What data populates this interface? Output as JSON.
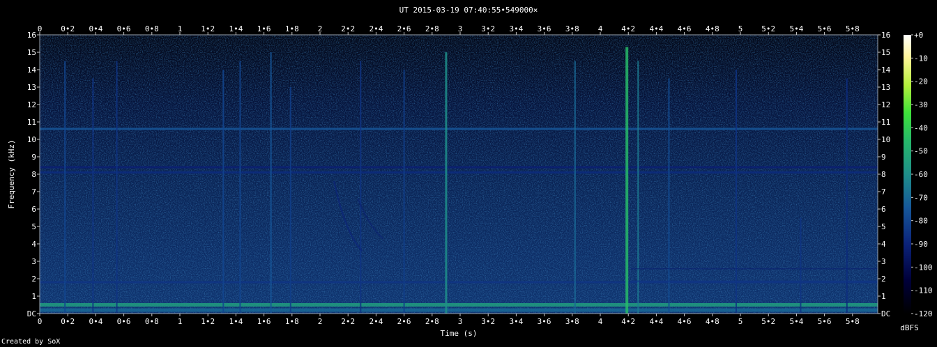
{
  "title": "UT 2015-03-19 07:40:55•549000×",
  "credit": "Created by SoX",
  "chart_data": {
    "type": "heatmap",
    "title": "UT 2015-03-19 07:40:55•549000×",
    "xlabel": "Time (s)",
    "ylabel": "Frequency (kHz)",
    "colorbar_label": "dBFS",
    "xlim": [
      0,
      5.98
    ],
    "ylim": [
      0,
      16
    ],
    "x_ticks": [
      "0",
      "0•2",
      "0•4",
      "0•6",
      "0•8",
      "1",
      "1•2",
      "1•4",
      "1•6",
      "1•8",
      "2",
      "2•2",
      "2•4",
      "2•6",
      "2•8",
      "3",
      "3•2",
      "3•4",
      "3•6",
      "3•8",
      "4",
      "4•2",
      "4•4",
      "4•6",
      "4•8",
      "5",
      "5•2",
      "5•4",
      "5•6",
      "5•8"
    ],
    "y_ticks": [
      "DC",
      "1",
      "2",
      "3",
      "4",
      "5",
      "6",
      "7",
      "8",
      "9",
      "10",
      "11",
      "12",
      "13",
      "14",
      "15",
      "16"
    ],
    "colorbar_ticks": [
      "+0",
      "-10",
      "-20",
      "-30",
      "-40",
      "-50",
      "-60",
      "-70",
      "-80",
      "-90",
      "-100",
      "-110",
      "-120"
    ],
    "colorbar_range": [
      -120,
      0
    ],
    "colors": [
      "#000000",
      "#000035",
      "#0a1f6e",
      "#134f8f",
      "#1f8a8a",
      "#25b86a",
      "#35e33a",
      "#bff04a",
      "#ffffc0",
      "#ffffff"
    ],
    "horizontal_lines_khz": [
      {
        "freq": 10.6,
        "level": -75
      },
      {
        "freq": 8.1,
        "level": -88
      },
      {
        "freq": 8.4,
        "level": -92
      },
      {
        "freq": 0.5,
        "level": -55
      },
      {
        "freq": 0.2,
        "level": -70
      },
      {
        "freq": 1.8,
        "level": -85
      }
    ],
    "vertical_spikes": [
      {
        "t": 0.18,
        "f_top": 14.5,
        "level": -80
      },
      {
        "t": 0.38,
        "f_top": 13.5,
        "level": -85
      },
      {
        "t": 0.55,
        "f_top": 14.5,
        "level": -85
      },
      {
        "t": 1.31,
        "f_top": 14.0,
        "level": -80
      },
      {
        "t": 1.43,
        "f_top": 14.5,
        "level": -80
      },
      {
        "t": 1.65,
        "f_top": 15.0,
        "level": -75
      },
      {
        "t": 1.79,
        "f_top": 13.0,
        "level": -82
      },
      {
        "t": 2.29,
        "f_top": 14.5,
        "level": -85
      },
      {
        "t": 2.6,
        "f_top": 14.0,
        "level": -82
      },
      {
        "t": 2.9,
        "f_top": 15.0,
        "level": -60
      },
      {
        "t": 3.82,
        "f_top": 14.5,
        "level": -70
      },
      {
        "t": 4.19,
        "f_top": 15.3,
        "level": -45
      },
      {
        "t": 4.27,
        "f_top": 14.5,
        "level": -65
      },
      {
        "t": 4.49,
        "f_top": 13.5,
        "level": -78
      },
      {
        "t": 4.97,
        "f_top": 14.0,
        "level": -85
      },
      {
        "t": 5.43,
        "f_top": 5.5,
        "level": -85
      },
      {
        "t": 5.76,
        "f_top": 13.5,
        "level": -88
      }
    ]
  }
}
